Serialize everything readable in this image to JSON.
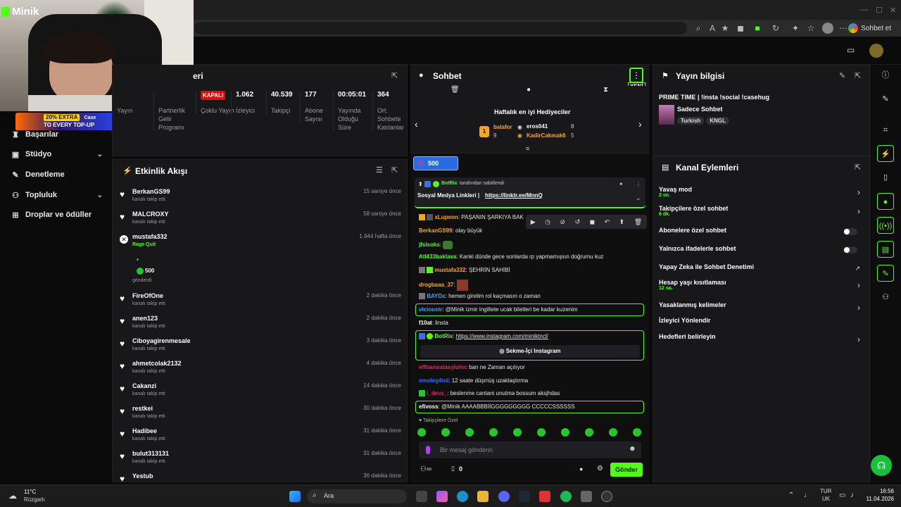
{
  "app": {
    "logo": "Minik",
    "chat_button": "Sohbet et"
  },
  "promo": {
    "line1": "20% EXTRA",
    "line2": "TO EVERY TOP-UP",
    "brand": "Case"
  },
  "leftnav": {
    "items": [
      {
        "label": "Başarılar",
        "icon": "trophy-icon",
        "chevron": false
      },
      {
        "label": "Stüdyo",
        "icon": "studio-icon",
        "chevron": true
      },
      {
        "label": "Denetleme",
        "icon": "wrench-icon",
        "chevron": false
      },
      {
        "label": "Topluluk",
        "icon": "community-icon",
        "chevron": true
      },
      {
        "label": "Droplar ve ödüller",
        "icon": "gift-icon",
        "chevron": false
      }
    ]
  },
  "stats": {
    "title_tail": "eri",
    "items": [
      {
        "value": "",
        "label": "Yayın"
      },
      {
        "value": "",
        "label": "Partnerlik Gelir Programı"
      },
      {
        "value": "KAPALI",
        "label": "Çoklu Yayın"
      },
      {
        "value": "1.062",
        "label": "İzleyici"
      },
      {
        "value": "40.539",
        "label": "Takipçi"
      },
      {
        "value": "177",
        "label": "Abone Sayısı"
      },
      {
        "value": "00:05:01",
        "label": "Yayında Olduğu Süre"
      },
      {
        "value": "364",
        "label": "Ort. Sohbete Katılanlar"
      }
    ]
  },
  "activity": {
    "title": "Etkinlik Akışı",
    "items": [
      {
        "name": "BerkanGS99",
        "sub": "kanalı takip etti",
        "time": "15 saniye önce"
      },
      {
        "name": "MALCROXY",
        "sub": "kanalı takip etti",
        "time": "58 saniye önce"
      },
      {
        "name": "mustafa332",
        "sub": "Rage Quit",
        "time": "1.944 hafta önce",
        "amount": "500",
        "extra": "gönderdi"
      },
      {
        "name": "FireOfOne",
        "sub": "kanalı takip etti",
        "time": "2 dakika önce"
      },
      {
        "name": "anen123",
        "sub": "kanalı takip etti",
        "time": "2 dakika önce"
      },
      {
        "name": "Ciboyagirenmesale",
        "sub": "kanalı takip etti",
        "time": "3 dakika önce"
      },
      {
        "name": "ahmetcolak2132",
        "sub": "kanalı takip etti",
        "time": "4 dakika önce"
      },
      {
        "name": "Cakanzi",
        "sub": "kanalı takip etti",
        "time": "14 dakika önce"
      },
      {
        "name": "restkei",
        "sub": "kanalı takip etti",
        "time": "30 dakika önce"
      },
      {
        "name": "Hadibee",
        "sub": "kanalı takip etti",
        "time": "31 dakika önce"
      },
      {
        "name": "bulut313131",
        "sub": "kanalı takip etti",
        "time": "31 dakika önce"
      },
      {
        "name": "Yestub",
        "sub": "",
        "time": "36 dakika önce"
      }
    ]
  },
  "chat": {
    "title": "Sohbet",
    "new_badge": "YENİ",
    "gifters_title": "Haftalık en iyi Hediyeciler",
    "gifters": [
      {
        "rank": "1",
        "name": "balafor",
        "count": "9",
        "color": "#f5a623"
      },
      {
        "name": "eros041",
        "count": "8",
        "color": "#ffffff"
      },
      {
        "name": "KadirCakmak6",
        "count": "5",
        "color": "#f5a623"
      }
    ],
    "sub_pill": "500",
    "pinned": {
      "by": "BotRix",
      "by_suffix": "tarafından sabitlendi",
      "text": "Sosyal Medya Linkleri | ",
      "link": "https://linktr.ee/MnnQ"
    },
    "messages": [
      {
        "user": "xLupenn",
        "color": "#f5a623",
        "text": "PAŞANIN ŞARKIYA BAK"
      },
      {
        "user": "BerkanGS99",
        "color": "#f5a623",
        "text": "olay büyük"
      },
      {
        "user": "jfslsoks",
        "color": "#53fc18",
        "text": ""
      },
      {
        "user": "Atl433baklava",
        "color": "#53fc18",
        "text": "Kanki dünde gece sonlarda rp yapmamışsın doğrumu kuz"
      },
      {
        "user": "mustafa332",
        "color": "#f5a623",
        "text": "ŞEHRİN SAHİBİ"
      },
      {
        "user": "drogbaaa_37",
        "color": "#f5a623",
        "text": ""
      },
      {
        "user": "BAYDx",
        "color": "#3aa0ff",
        "text": "hemen girelim rol kaçmasın o zaman"
      },
      {
        "user": "vicioustr",
        "color": "#3aa0ff",
        "text": "@Minik izmir ingiltete ucak biletleri be kadar kuzenim"
      },
      {
        "user": "f10at",
        "color": "#ffffff",
        "text": "linsta"
      },
      {
        "user": "BotRix",
        "color": "#53fc18",
        "text": "https://www.instagram.com/miniktncl/",
        "button": "Sekme-İçi Instagram"
      },
      {
        "user": "efflsunratasyluho",
        "color": "#e91e63",
        "text": "ban ne Zaman açılıyor"
      },
      {
        "user": "emoleg4nd",
        "color": "#3a6bff",
        "text": "12 saate düşmüş uzaklaştırma"
      },
      {
        "user": "i_devz_",
        "color": "#e91e63",
        "text": "beslenme cantani unutma bossum aksjhdas"
      },
      {
        "user": "efivoss",
        "color": "#ffffff",
        "text": "@Minik AAAABBBİİGGGGGGGGG CCCCCSSSSSS"
      }
    ],
    "followers_only": "Takipçilere Özel",
    "input_placeholder": "Bir mesaj gönderin",
    "count": "0",
    "send": "Gönder"
  },
  "info": {
    "title": "Yayın bilgisi",
    "stream_title": "PRIME TIME | !insta !social !casehug",
    "category": "Sadece Sohbet",
    "tags": [
      "Turkish",
      "KNGL"
    ]
  },
  "actions": {
    "title": "Kanal Eylemleri",
    "items": [
      {
        "label": "Yavaş mod",
        "sub": "2 sn.",
        "control": "chevron"
      },
      {
        "label": "Takipçilere özel sohbet",
        "sub": "6 dk.",
        "control": "chevron"
      },
      {
        "label": "Abonelere özel sohbet",
        "sub": "",
        "control": "toggle"
      },
      {
        "label": "Yalnızca ifadelerle sohbet",
        "sub": "",
        "control": "toggle"
      },
      {
        "label": "Yapay Zeka ile Sohbet Denetimi",
        "sub": "",
        "control": "external"
      },
      {
        "label": "Hesap yaşı kısıtlaması",
        "sub": "12 sa.",
        "control": "chevron"
      },
      {
        "label": "Yasaklanmış kelimeler",
        "sub": "",
        "control": "chevron"
      },
      {
        "label": "İzleyici Yönlendir",
        "sub": "",
        "control": "none"
      },
      {
        "label": "Hedefleri belirleyin",
        "sub": "",
        "control": "chevron"
      }
    ]
  },
  "taskbar": {
    "weather_temp": "11°C",
    "weather_text": "Rüzgarlı",
    "search": "Ara",
    "lang1": "TUR",
    "lang2": "UK",
    "time": "16:56",
    "date": "11.04.2026"
  },
  "colors": {
    "accent": "#53fc18",
    "panel": "#18181b",
    "background": "#0a0a0a",
    "live_off": "#eb0400"
  }
}
